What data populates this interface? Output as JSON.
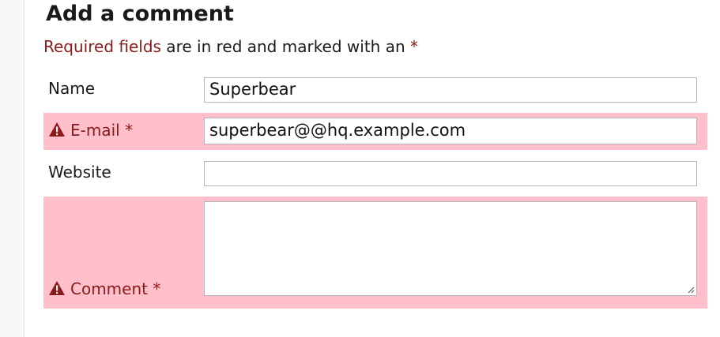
{
  "form": {
    "heading": "Add a comment",
    "required_note": {
      "highlight": "Required fields",
      "rest": " are in red and marked with an ",
      "marker": "*"
    },
    "fields": {
      "name": {
        "label": "Name",
        "value": "Superbear"
      },
      "email": {
        "label": "E-mail *",
        "value": "superbear@@hq.example.com",
        "error": true
      },
      "website": {
        "label": "Website",
        "value": ""
      },
      "comment": {
        "label": "Comment *",
        "value": "",
        "error": true
      }
    }
  },
  "colors": {
    "error_background": "#ffc0cb",
    "error_text": "#8b1a1a",
    "input_border": "#b5b5b5"
  },
  "icons": {
    "error": "warning-triangle-icon",
    "textarea_resize": "resize-grip-icon"
  }
}
